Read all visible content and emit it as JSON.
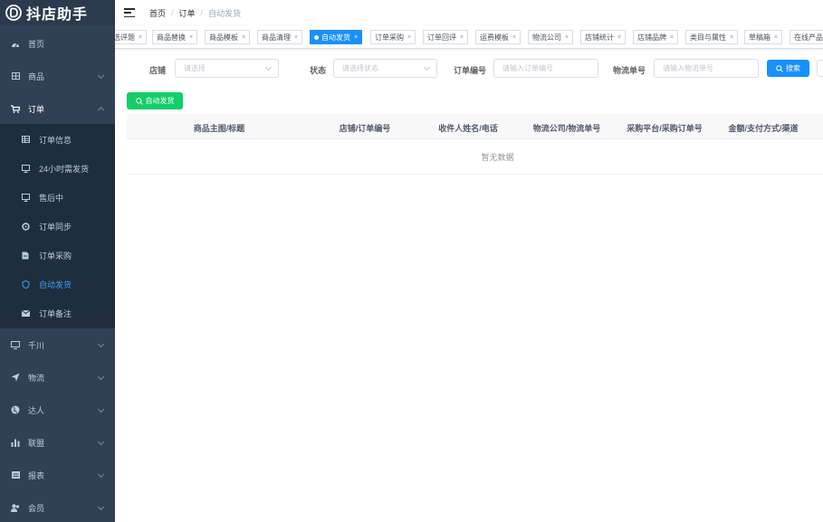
{
  "app": {
    "title": "抖店助手"
  },
  "sidebar": {
    "items": [
      {
        "label": "首页",
        "icon": "dashboard-icon"
      },
      {
        "label": "商品",
        "icon": "grid-icon"
      },
      {
        "label": "订单",
        "icon": "cart-icon"
      },
      {
        "label": "千川",
        "icon": "monitor-icon"
      },
      {
        "label": "物流",
        "icon": "send-icon"
      },
      {
        "label": "达人",
        "icon": "globe-icon"
      },
      {
        "label": "联盟",
        "icon": "bar-chart-icon"
      },
      {
        "label": "报表",
        "icon": "report-icon"
      },
      {
        "label": "会员",
        "icon": "user-icon"
      }
    ],
    "order_submenu": [
      {
        "label": "订单信息",
        "icon": "table-icon"
      },
      {
        "label": "24小时需发货",
        "icon": "monitor-icon"
      },
      {
        "label": "售后中",
        "icon": "monitor-icon"
      },
      {
        "label": "订单同步",
        "icon": "sync-icon"
      },
      {
        "label": "订单采购",
        "icon": "document-icon"
      },
      {
        "label": "自动发货",
        "icon": "shield-icon"
      },
      {
        "label": "订单备注",
        "icon": "mail-icon"
      }
    ]
  },
  "header": {
    "breadcrumb": [
      "首页",
      "订单",
      "自动发货"
    ],
    "separator": "/"
  },
  "tags": [
    "选评题",
    "商品替换",
    "商品模板",
    "商品清理",
    "自动发货",
    "订单采购",
    "订单回评",
    "运费模板",
    "物流公司",
    "店铺统计",
    "店铺品牌",
    "类目与属性",
    "草稿箱",
    "在线产品"
  ],
  "close_glyph": "×",
  "search": {
    "shop_label": "店铺",
    "shop_placeholder": "请选择",
    "status_label": "状态",
    "status_placeholder": "请选择状态",
    "order_no_label": "订单编号",
    "order_no_placeholder": "请输入订单编号",
    "logistics_no_label": "物流单号",
    "logistics_no_placeholder": "请输入物流单号",
    "search_button": "搜索"
  },
  "toolbar": {
    "auto_ship_button": "自动发货"
  },
  "table": {
    "columns": [
      "商品主图/标题",
      "店铺/订单编号",
      "收件人姓名/电话",
      "物流公司/物流单号",
      "采购平台/采购订单号",
      "金额/支付方式/渠道"
    ],
    "empty_text": "暂无数据"
  },
  "colors": {
    "sidebar_bg": "#304156",
    "submenu_bg": "#1f2d3d",
    "primary": "#1890ff",
    "success": "#13ce66",
    "active_menu_text": "#409eff"
  }
}
